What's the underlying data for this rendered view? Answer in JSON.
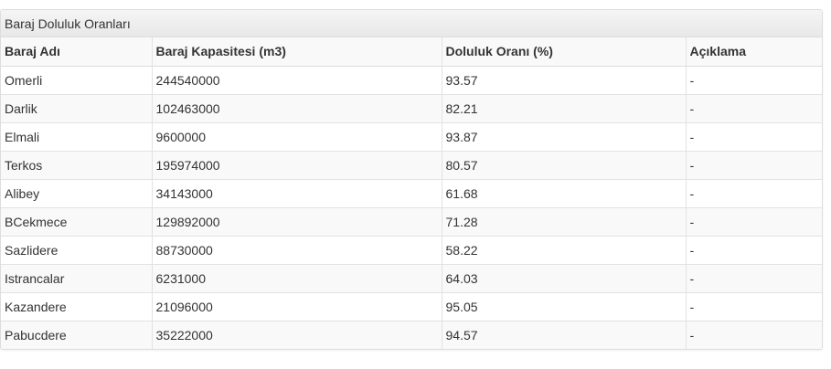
{
  "panel": {
    "title": "Baraj Doluluk Oranları"
  },
  "table": {
    "headers": [
      "Baraj Adı",
      "Baraj Kapasitesi (m3)",
      "Doluluk Oranı (%)",
      "Açıklama"
    ],
    "rows": [
      [
        "Omerli",
        "244540000",
        "93.57",
        "-"
      ],
      [
        "Darlik",
        "102463000",
        "82.21",
        "-"
      ],
      [
        "Elmali",
        "9600000",
        "93.87",
        "-"
      ],
      [
        "Terkos",
        "195974000",
        "80.57",
        "-"
      ],
      [
        "Alibey",
        "34143000",
        "61.68",
        "-"
      ],
      [
        "BCekmece",
        "129892000",
        "71.28",
        "-"
      ],
      [
        "Sazlidere",
        "88730000",
        "58.22",
        "-"
      ],
      [
        "Istrancalar",
        "6231000",
        "64.03",
        "-"
      ],
      [
        "Kazandere",
        "21096000",
        "95.05",
        "-"
      ],
      [
        "Pabucdere",
        "35222000",
        "94.57",
        "-"
      ]
    ]
  }
}
